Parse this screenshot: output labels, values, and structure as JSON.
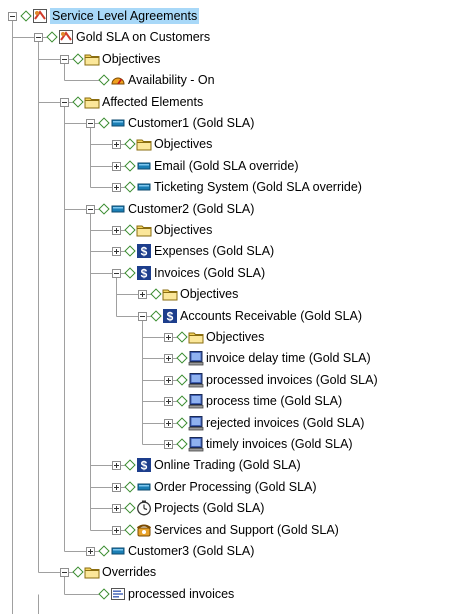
{
  "tree": {
    "nodes": [
      {
        "depth": 0,
        "label": "Service Level Agreements",
        "icon": "sla-icon",
        "expanded": true,
        "has_children": true,
        "selected": true
      },
      {
        "depth": 1,
        "label": "Gold SLA on Customers",
        "icon": "sla-icon",
        "expanded": true,
        "has_children": true
      },
      {
        "depth": 2,
        "label": "Objectives",
        "icon": "folder-icon",
        "expanded": true,
        "has_children": true
      },
      {
        "depth": 3,
        "label": "Availability - On",
        "icon": "gauge-icon",
        "has_children": false
      },
      {
        "depth": 2,
        "label": "Affected Elements",
        "icon": "folder-icon",
        "expanded": true,
        "has_children": true
      },
      {
        "depth": 3,
        "label": "Customer1 (Gold SLA)",
        "icon": "customer-icon",
        "expanded": true,
        "has_children": true
      },
      {
        "depth": 4,
        "label": "Objectives",
        "icon": "folder-icon",
        "expanded": false,
        "has_children": true
      },
      {
        "depth": 4,
        "label": "Email (Gold SLA override)",
        "icon": "customer-icon",
        "expanded": false,
        "has_children": true
      },
      {
        "depth": 4,
        "label": "Ticketing System (Gold SLA override)",
        "icon": "customer-icon",
        "expanded": false,
        "has_children": true
      },
      {
        "depth": 3,
        "label": "Customer2 (Gold SLA)",
        "icon": "customer-icon",
        "expanded": true,
        "has_children": true
      },
      {
        "depth": 4,
        "label": "Objectives",
        "icon": "folder-icon",
        "expanded": false,
        "has_children": true
      },
      {
        "depth": 4,
        "label": "Expenses (Gold SLA)",
        "icon": "dollar-icon",
        "expanded": false,
        "has_children": true
      },
      {
        "depth": 4,
        "label": "Invoices (Gold SLA)",
        "icon": "dollar-icon",
        "expanded": true,
        "has_children": true
      },
      {
        "depth": 5,
        "label": "Objectives",
        "icon": "folder-icon",
        "expanded": false,
        "has_children": true
      },
      {
        "depth": 5,
        "label": "Accounts Receivable (Gold SLA)",
        "icon": "dollar-icon",
        "expanded": true,
        "has_children": true
      },
      {
        "depth": 6,
        "label": "Objectives",
        "icon": "folder-icon",
        "expanded": false,
        "has_children": true
      },
      {
        "depth": 6,
        "label": "invoice delay time (Gold SLA)",
        "icon": "computer-icon",
        "expanded": false,
        "has_children": true
      },
      {
        "depth": 6,
        "label": "processed invoices (Gold SLA)",
        "icon": "computer-icon",
        "expanded": false,
        "has_children": true
      },
      {
        "depth": 6,
        "label": "process time (Gold SLA)",
        "icon": "computer-icon",
        "expanded": false,
        "has_children": true
      },
      {
        "depth": 6,
        "label": "rejected invoices (Gold SLA)",
        "icon": "computer-icon",
        "expanded": false,
        "has_children": true
      },
      {
        "depth": 6,
        "label": "timely invoices (Gold SLA)",
        "icon": "computer-icon",
        "expanded": false,
        "has_children": true
      },
      {
        "depth": 4,
        "label": "Online Trading (Gold SLA)",
        "icon": "dollar-icon",
        "expanded": false,
        "has_children": true
      },
      {
        "depth": 4,
        "label": "Order Processing (Gold SLA)",
        "icon": "customer-icon",
        "expanded": false,
        "has_children": true
      },
      {
        "depth": 4,
        "label": "Projects (Gold SLA)",
        "icon": "clock-icon",
        "expanded": false,
        "has_children": true
      },
      {
        "depth": 4,
        "label": "Services and Support (Gold SLA)",
        "icon": "phone-icon",
        "expanded": false,
        "has_children": true
      },
      {
        "depth": 3,
        "label": "Customer3 (Gold SLA)",
        "icon": "customer-icon",
        "expanded": false,
        "has_children": true
      },
      {
        "depth": 2,
        "label": "Overrides",
        "icon": "folder-icon",
        "expanded": true,
        "has_children": true
      },
      {
        "depth": 3,
        "label": "processed invoices",
        "icon": "override-icon",
        "has_children": false
      }
    ]
  },
  "colors": {
    "selection": "#a8d8f8",
    "diamond": "#3a8c2f",
    "folder": "#f4d35e",
    "customer": "#1b7fb5",
    "line": "#a0a0a0"
  }
}
